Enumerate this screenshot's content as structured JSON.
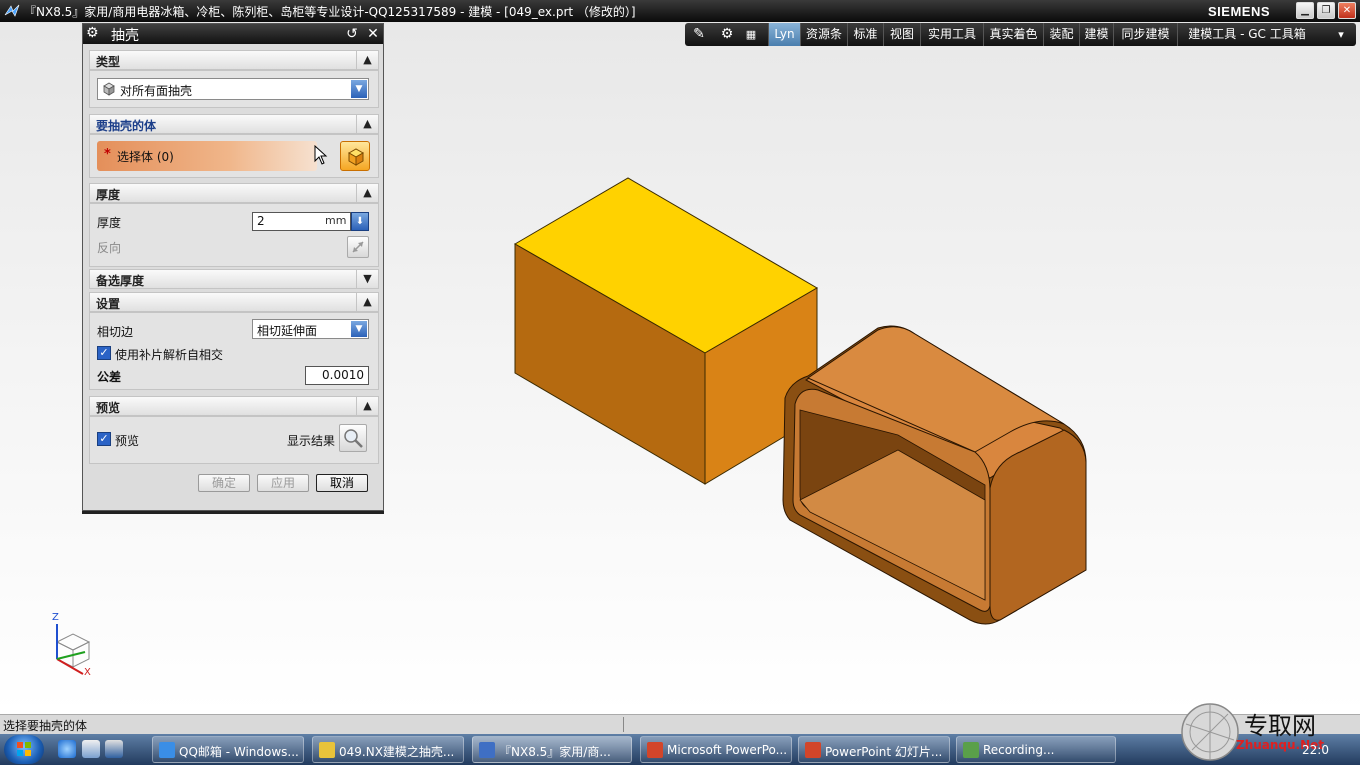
{
  "window": {
    "title": "『NX8.5』家用/商用电器冰箱、冷柜、陈列柜、岛柜等专业设计-QQ125317589 - 建模 - [049_ex.prt （修改的）]",
    "brand": "SIEMENS",
    "min_label": "▁",
    "restore_label": "❐",
    "close_label": "✕"
  },
  "toolbar": {
    "items": [
      "Lyn",
      "资源条",
      "标准",
      "视图",
      "实用工具",
      "真实着色",
      "装配",
      "建模",
      "同步建模",
      "建模工具 - GC 工具箱"
    ],
    "active": "Lyn"
  },
  "dialog": {
    "title": "抽壳",
    "groups": {
      "type": {
        "header": "类型",
        "value": "对所有面抽壳"
      },
      "body": {
        "header": "要抽壳的体",
        "select_label": "选择体 (0)",
        "required_mark": "*"
      },
      "thickness": {
        "header": "厚度",
        "thickness_label": "厚度",
        "thickness_value": "2",
        "unit": "mm",
        "reverse_label": "反向"
      },
      "alt_thickness": {
        "header": "备选厚度"
      },
      "settings": {
        "header": "设置",
        "tangent_label": "相切边",
        "tangent_value": "相切延伸面",
        "patch_label": "使用补片解析自相交",
        "patch_checked": true,
        "tolerance_label": "公差",
        "tolerance_value": "0.0010"
      },
      "preview": {
        "header": "预览",
        "preview_label": "预览",
        "preview_checked": true,
        "show_result_label": "显示结果"
      }
    },
    "buttons": {
      "ok": "确定",
      "apply": "应用",
      "cancel": "取消"
    }
  },
  "triad": {
    "z": "Z",
    "x": "X"
  },
  "status": {
    "prompt": "选择要抽壳的体"
  },
  "taskbar": {
    "tasks": [
      {
        "label": "QQ邮箱 - Windows...",
        "icon_color": "#3a8ee6"
      },
      {
        "label": "049.NX建模之抽壳...",
        "icon_color": "#e8c33a"
      },
      {
        "label": "『NX8.5』家用/商...",
        "icon_color": "#3f6fc4",
        "active": true
      },
      {
        "label": "Microsoft PowerPo...",
        "icon_color": "#d2452a"
      },
      {
        "label": "PowerPoint 幻灯片...",
        "icon_color": "#d2452a"
      },
      {
        "label": "Recording...",
        "icon_color": "#5aa04a"
      }
    ],
    "clock": "22:0"
  },
  "watermark": {
    "text": "专取网",
    "url": "Zhuanqu.Net"
  }
}
